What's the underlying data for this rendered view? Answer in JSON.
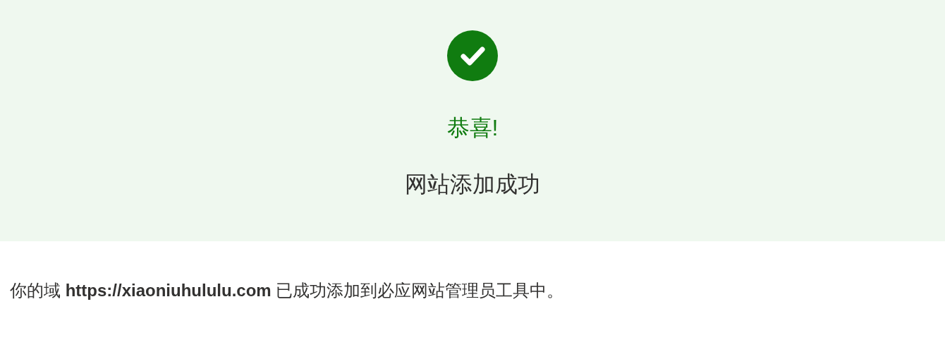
{
  "banner": {
    "title": "恭喜!",
    "subtitle": "网站添加成功"
  },
  "message": "你的域 **https://xiaoniuhululu.com** 已成功添加到必应网站管理员工具中。"
}
